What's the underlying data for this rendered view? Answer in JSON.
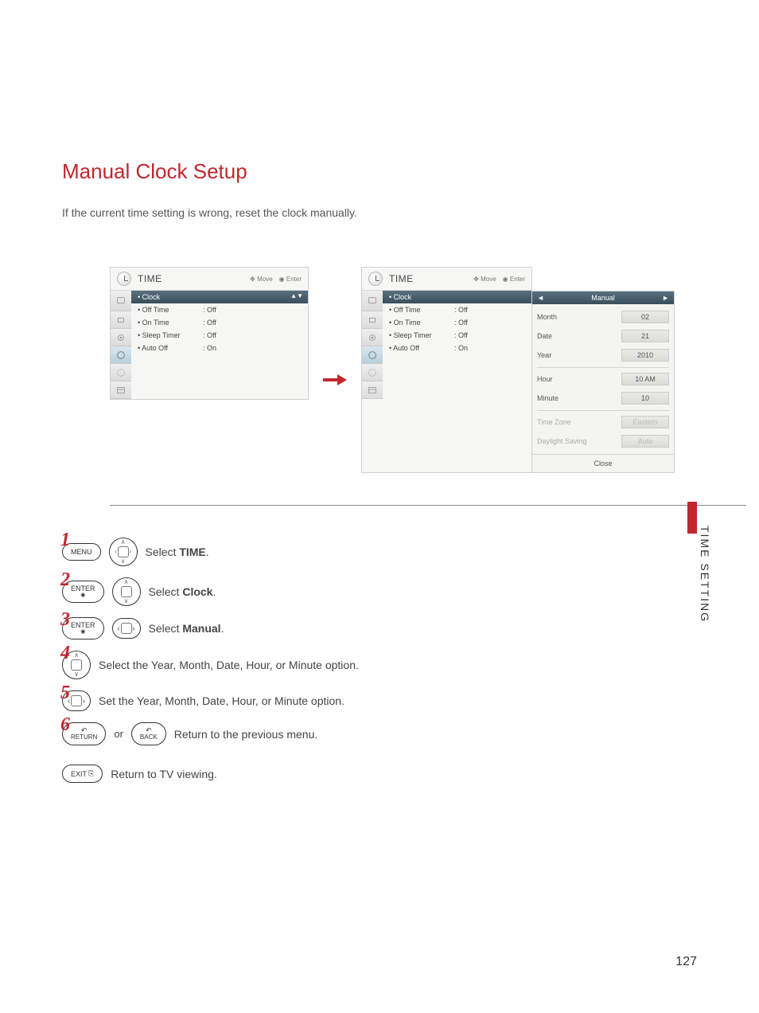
{
  "heading": "Manual Clock Setup",
  "intro": "If the current time setting is wrong, reset the clock manually.",
  "osd": {
    "title": "TIME",
    "hint_move": "Move",
    "hint_enter": "Enter",
    "items": [
      {
        "label": "Clock",
        "val": ""
      },
      {
        "label": "Off Time",
        "val": ": Off"
      },
      {
        "label": "On Time",
        "val": ": Off"
      },
      {
        "label": "Sleep Timer",
        "val": ": Off"
      },
      {
        "label": "Auto Off",
        "val": ": On"
      }
    ]
  },
  "popup": {
    "mode": "Manual",
    "rows": [
      {
        "label": "Month",
        "val": "02"
      },
      {
        "label": "Date",
        "val": "21"
      },
      {
        "label": "Year",
        "val": "2010"
      },
      {
        "label": "Hour",
        "val": "10 AM"
      },
      {
        "label": "Minute",
        "val": "10"
      },
      {
        "label": "Time Zone",
        "val": "Eastern"
      },
      {
        "label": "Daylight Saving",
        "val": "Auto"
      }
    ],
    "close": "Close"
  },
  "steps": {
    "s1": {
      "btn": "MENU",
      "text_pre": "Select ",
      "text_bold": "TIME",
      "text_post": "."
    },
    "s2": {
      "btn": "ENTER",
      "text_pre": "Select ",
      "text_bold": "Clock",
      "text_post": "."
    },
    "s3": {
      "btn": "ENTER",
      "text_pre": "Select ",
      "text_bold": "Manual",
      "text_post": "."
    },
    "s4": {
      "text": "Select the Year, Month, Date, Hour, or Minute option."
    },
    "s5": {
      "text": "Set the Year, Month, Date, Hour, or Minute option."
    },
    "s6": {
      "btn1": "RETURN",
      "or": "or",
      "btn2": "BACK",
      "text": "Return to the previous menu."
    },
    "s7": {
      "btn": "EXIT",
      "text": "Return to TV viewing."
    }
  },
  "sidetab": "TIME SETTING",
  "pagenum": "127"
}
